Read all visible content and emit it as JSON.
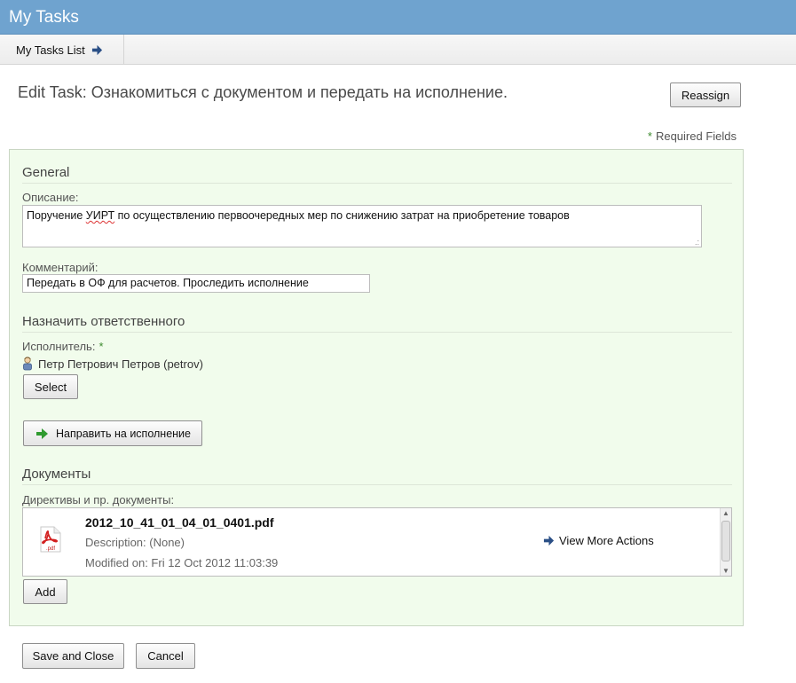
{
  "app": {
    "title": "My Tasks"
  },
  "nav": {
    "tab_label": "My Tasks List"
  },
  "page": {
    "title": "Edit Task: Ознакомиться с документом и передать на исполнение.",
    "reassign_label": "Reassign",
    "required_star": "*",
    "required_text": "Required Fields"
  },
  "general": {
    "heading": "General",
    "description_label": "Описание:",
    "description_before": "Поручение ",
    "description_misspelled": "УИРТ",
    "description_after": " по осуществлению первоочередных мер по снижению затрат на приобретение товаров",
    "comment_label": "Комментарий:",
    "comment_value": "Передать в ОФ для расчетов. Проследить исполнение"
  },
  "assign": {
    "heading": "Назначить ответственного",
    "assignee_label": "Исполнитель:",
    "assignee_star": "*",
    "assignee_name": "Петр Петрович Петров (petrov)",
    "select_label": "Select",
    "forward_label": "Направить на исполнение"
  },
  "documents": {
    "heading": "Документы",
    "list_label": "Директивы и пр. документы:",
    "items": [
      {
        "name": "2012_10_41_01_04_01_0401.pdf",
        "description": "Description: (None)",
        "modified": "Modified on: Fri 12 Oct 2012 11:03:39",
        "icon_text": ".pdf",
        "actions_label": "View More Actions"
      }
    ],
    "add_label": "Add"
  },
  "footer": {
    "save_label": "Save and Close",
    "cancel_label": "Cancel"
  },
  "colors": {
    "titlebar": "#6fa3cf",
    "panel_bg": "#f1fcec",
    "required_star": "#3c8a2e",
    "arrow_blue": "#2a4f86",
    "arrow_green": "#2f9a2f"
  },
  "icons": {
    "nav_arrow": "arrow-right-icon",
    "forward": "green-arrow-right-icon",
    "person": "person-icon",
    "pdf": "pdf-file-icon",
    "view_more": "arrow-right-icon"
  }
}
